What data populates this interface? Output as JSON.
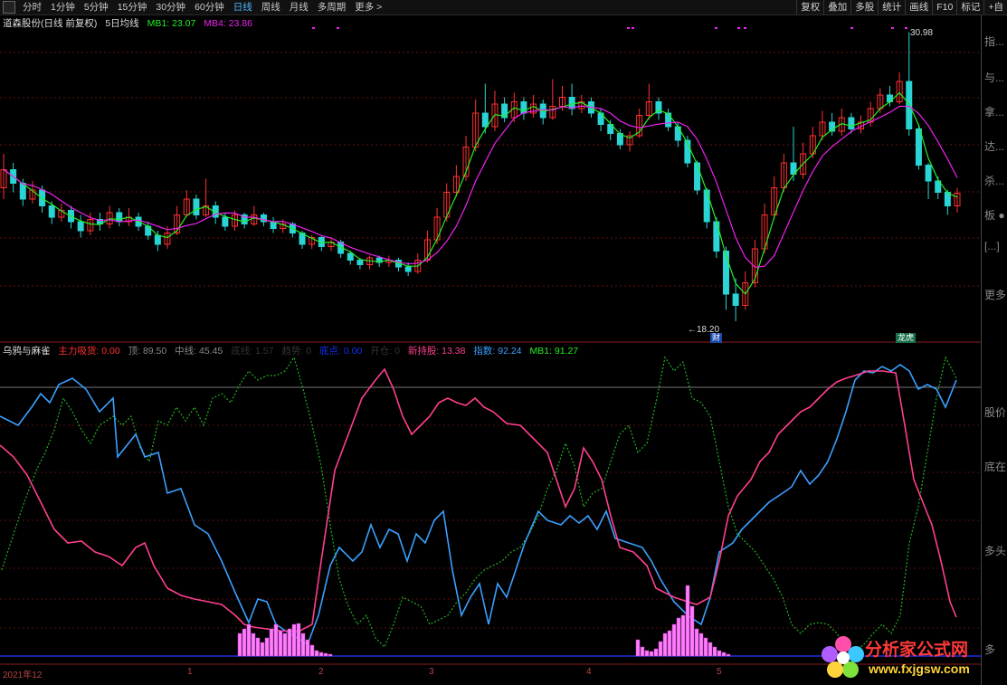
{
  "toolbar": {
    "periods": [
      "分时",
      "1分钟",
      "5分钟",
      "15分钟",
      "30分钟",
      "60分钟",
      "日线",
      "周线",
      "月线",
      "多周期",
      "更多 >"
    ],
    "active_period": "日线",
    "right_buttons": [
      "复权",
      "叠加",
      "多股",
      "统计",
      "画线",
      "F10",
      "标记",
      "+自"
    ]
  },
  "stock": {
    "name": "道森股份(日线 前复权)",
    "ma_label": "5日均线",
    "mb1": "MB1: 23.07",
    "mb4": "MB4: 23.86",
    "high_label": "30.98",
    "low_label": "←18.20",
    "badge_cai": "财",
    "badge_longhu": "龙虎"
  },
  "indicator": {
    "name": "乌鸦与麻雀",
    "zhuli": "主力吸货: 0.00",
    "ding": "顶: 89.50",
    "zhongxian": "中线: 45.45",
    "dim1": "底线: 1.57",
    "dim2": "趋势: 0",
    "bottom": "底点: 0.00",
    "dim3": "开仓: 0",
    "holder": "新持股: 13.38",
    "index": "指数: 92.24",
    "mb1": "MB1: 91.27"
  },
  "right_panel": [
    "指...",
    "与...",
    "拿...",
    "达...",
    "杀...",
    "板 ●",
    "[...]",
    "更多",
    "股价",
    "底在",
    "多头",
    "多"
  ],
  "axis": {
    "d0": "2021年12",
    "d1": "1",
    "d2": "2",
    "d3": "3",
    "d4": "4",
    "d5": "5"
  },
  "watermark": {
    "title": "分析家公式网",
    "url": "www.fxjgsw.com"
  },
  "colors": {
    "up": "#ff3030",
    "down": "#2ad4d4",
    "ma_green": "#22ee22",
    "ma_magenta": "#ee22ee",
    "pink": "#ff3f8f",
    "blue": "#3aa0ff",
    "dotted": "#22b022",
    "bar": "#ff7cff"
  },
  "chart_data": {
    "type": "candlestick+lines",
    "candles_approx": [
      {
        "o": 24.1,
        "c": 24.9,
        "h": 25.6,
        "l": 23.6
      },
      {
        "o": 24.9,
        "c": 24.3,
        "h": 25.2,
        "l": 23.9
      },
      {
        "o": 24.3,
        "c": 23.6,
        "h": 24.5,
        "l": 23.3
      },
      {
        "o": 23.6,
        "c": 24.0,
        "h": 24.4,
        "l": 23.4
      },
      {
        "o": 24.0,
        "c": 23.3,
        "h": 24.2,
        "l": 23.0
      },
      {
        "o": 23.3,
        "c": 22.8,
        "h": 23.5,
        "l": 22.5
      },
      {
        "o": 22.8,
        "c": 23.1,
        "h": 23.4,
        "l": 22.6
      },
      {
        "o": 23.1,
        "c": 22.6,
        "h": 23.3,
        "l": 22.3
      },
      {
        "o": 22.6,
        "c": 22.2,
        "h": 22.9,
        "l": 21.9
      },
      {
        "o": 22.2,
        "c": 22.7,
        "h": 23.0,
        "l": 22.0
      },
      {
        "o": 22.7,
        "c": 22.5,
        "h": 23.0,
        "l": 22.2
      },
      {
        "o": 22.5,
        "c": 23.0,
        "h": 23.3,
        "l": 22.3
      },
      {
        "o": 23.0,
        "c": 22.6,
        "h": 23.2,
        "l": 22.4
      },
      {
        "o": 22.6,
        "c": 22.8,
        "h": 23.2,
        "l": 22.4
      },
      {
        "o": 22.8,
        "c": 22.4,
        "h": 23.0,
        "l": 22.2
      },
      {
        "o": 22.4,
        "c": 22.0,
        "h": 22.6,
        "l": 21.8
      },
      {
        "o": 22.0,
        "c": 21.6,
        "h": 22.2,
        "l": 21.3
      },
      {
        "o": 21.6,
        "c": 22.1,
        "h": 22.4,
        "l": 21.4
      },
      {
        "o": 22.1,
        "c": 22.9,
        "h": 23.3,
        "l": 22.0
      },
      {
        "o": 22.9,
        "c": 23.6,
        "h": 24.0,
        "l": 22.8
      },
      {
        "o": 23.6,
        "c": 22.9,
        "h": 23.8,
        "l": 22.7
      },
      {
        "o": 22.9,
        "c": 23.3,
        "h": 24.5,
        "l": 22.8
      },
      {
        "o": 23.3,
        "c": 22.8,
        "h": 23.5,
        "l": 22.5
      },
      {
        "o": 22.8,
        "c": 22.4,
        "h": 23.0,
        "l": 22.2
      },
      {
        "o": 22.4,
        "c": 22.9,
        "h": 23.1,
        "l": 22.2
      },
      {
        "o": 22.9,
        "c": 22.5,
        "h": 23.0,
        "l": 22.3
      },
      {
        "o": 22.5,
        "c": 22.9,
        "h": 23.3,
        "l": 22.4
      },
      {
        "o": 22.9,
        "c": 22.6,
        "h": 23.0,
        "l": 22.4
      },
      {
        "o": 22.6,
        "c": 22.3,
        "h": 22.8,
        "l": 22.1
      },
      {
        "o": 22.3,
        "c": 22.5,
        "h": 22.7,
        "l": 22.1
      },
      {
        "o": 22.5,
        "c": 22.1,
        "h": 22.6,
        "l": 21.9
      },
      {
        "o": 22.1,
        "c": 21.6,
        "h": 22.2,
        "l": 21.4
      },
      {
        "o": 21.6,
        "c": 21.9,
        "h": 22.0,
        "l": 21.4
      },
      {
        "o": 21.9,
        "c": 21.5,
        "h": 22.0,
        "l": 21.3
      },
      {
        "o": 21.5,
        "c": 21.7,
        "h": 21.9,
        "l": 21.3
      },
      {
        "o": 21.7,
        "c": 21.2,
        "h": 21.8,
        "l": 21.0
      },
      {
        "o": 21.2,
        "c": 20.9,
        "h": 21.3,
        "l": 20.7
      },
      {
        "o": 20.9,
        "c": 20.7,
        "h": 21.0,
        "l": 20.5
      },
      {
        "o": 20.7,
        "c": 21.0,
        "h": 21.1,
        "l": 20.5
      },
      {
        "o": 21.0,
        "c": 20.8,
        "h": 21.1,
        "l": 20.6
      },
      {
        "o": 20.8,
        "c": 20.9,
        "h": 21.1,
        "l": 20.6
      },
      {
        "o": 20.9,
        "c": 20.6,
        "h": 21.0,
        "l": 20.4
      },
      {
        "o": 20.6,
        "c": 20.4,
        "h": 20.8,
        "l": 20.2
      },
      {
        "o": 20.4,
        "c": 20.9,
        "h": 21.2,
        "l": 20.3
      },
      {
        "o": 20.9,
        "c": 21.8,
        "h": 22.2,
        "l": 20.8
      },
      {
        "o": 21.8,
        "c": 22.8,
        "h": 23.2,
        "l": 21.6
      },
      {
        "o": 22.8,
        "c": 23.9,
        "h": 24.3,
        "l": 22.6
      },
      {
        "o": 23.9,
        "c": 24.6,
        "h": 25.1,
        "l": 23.7
      },
      {
        "o": 24.6,
        "c": 25.9,
        "h": 26.4,
        "l": 24.4
      },
      {
        "o": 25.9,
        "c": 27.4,
        "h": 28.0,
        "l": 25.7
      },
      {
        "o": 27.4,
        "c": 26.8,
        "h": 28.7,
        "l": 26.5
      },
      {
        "o": 26.8,
        "c": 27.8,
        "h": 28.4,
        "l": 26.6
      },
      {
        "o": 27.8,
        "c": 27.2,
        "h": 28.1,
        "l": 27.0
      },
      {
        "o": 27.2,
        "c": 27.9,
        "h": 28.3,
        "l": 27.0
      },
      {
        "o": 27.9,
        "c": 27.4,
        "h": 28.1,
        "l": 27.1
      },
      {
        "o": 27.4,
        "c": 27.8,
        "h": 28.2,
        "l": 27.2
      },
      {
        "o": 27.8,
        "c": 27.2,
        "h": 28.0,
        "l": 26.9
      },
      {
        "o": 27.2,
        "c": 27.7,
        "h": 28.9,
        "l": 27.1
      },
      {
        "o": 27.7,
        "c": 28.1,
        "h": 28.6,
        "l": 27.5
      },
      {
        "o": 28.1,
        "c": 27.6,
        "h": 28.7,
        "l": 27.3
      },
      {
        "o": 27.6,
        "c": 27.9,
        "h": 28.2,
        "l": 27.4
      },
      {
        "o": 27.9,
        "c": 27.4,
        "h": 28.1,
        "l": 27.2
      },
      {
        "o": 27.4,
        "c": 26.9,
        "h": 27.6,
        "l": 26.6
      },
      {
        "o": 26.9,
        "c": 26.5,
        "h": 27.1,
        "l": 26.2
      },
      {
        "o": 26.5,
        "c": 26.0,
        "h": 26.7,
        "l": 25.8
      },
      {
        "o": 26.0,
        "c": 26.4,
        "h": 26.6,
        "l": 25.7
      },
      {
        "o": 26.4,
        "c": 27.3,
        "h": 27.6,
        "l": 26.3
      },
      {
        "o": 27.3,
        "c": 27.9,
        "h": 28.7,
        "l": 27.1
      },
      {
        "o": 27.9,
        "c": 27.4,
        "h": 28.1,
        "l": 27.1
      },
      {
        "o": 27.4,
        "c": 26.8,
        "h": 27.6,
        "l": 26.6
      },
      {
        "o": 26.8,
        "c": 26.2,
        "h": 27.0,
        "l": 25.9
      },
      {
        "o": 26.2,
        "c": 25.2,
        "h": 26.4,
        "l": 25.0
      },
      {
        "o": 25.2,
        "c": 24.0,
        "h": 25.3,
        "l": 23.8
      },
      {
        "o": 24.0,
        "c": 22.6,
        "h": 24.1,
        "l": 22.3
      },
      {
        "o": 22.6,
        "c": 21.3,
        "h": 22.8,
        "l": 21.0
      },
      {
        "o": 21.3,
        "c": 19.4,
        "h": 21.5,
        "l": 18.7
      },
      {
        "o": 19.4,
        "c": 18.9,
        "h": 20.1,
        "l": 18.2
      },
      {
        "o": 18.9,
        "c": 19.9,
        "h": 20.4,
        "l": 18.7
      },
      {
        "o": 19.9,
        "c": 21.4,
        "h": 21.8,
        "l": 19.7
      },
      {
        "o": 21.4,
        "c": 22.9,
        "h": 23.4,
        "l": 21.2
      },
      {
        "o": 22.9,
        "c": 24.1,
        "h": 24.6,
        "l": 22.7
      },
      {
        "o": 24.1,
        "c": 25.2,
        "h": 25.6,
        "l": 23.9
      },
      {
        "o": 25.2,
        "c": 24.7,
        "h": 26.8,
        "l": 24.4
      },
      {
        "o": 24.7,
        "c": 25.6,
        "h": 26.1,
        "l": 24.5
      },
      {
        "o": 25.6,
        "c": 26.4,
        "h": 26.8,
        "l": 25.4
      },
      {
        "o": 26.4,
        "c": 27.0,
        "h": 27.5,
        "l": 26.2
      },
      {
        "o": 27.0,
        "c": 26.6,
        "h": 27.4,
        "l": 26.4
      },
      {
        "o": 26.6,
        "c": 27.2,
        "h": 27.6,
        "l": 26.4
      },
      {
        "o": 27.2,
        "c": 26.7,
        "h": 27.4,
        "l": 26.5
      },
      {
        "o": 26.7,
        "c": 27.0,
        "h": 27.3,
        "l": 26.5
      },
      {
        "o": 27.0,
        "c": 27.6,
        "h": 27.9,
        "l": 26.8
      },
      {
        "o": 27.6,
        "c": 28.2,
        "h": 28.5,
        "l": 27.4
      },
      {
        "o": 28.2,
        "c": 27.9,
        "h": 28.6,
        "l": 27.7
      },
      {
        "o": 27.9,
        "c": 28.8,
        "h": 29.2,
        "l": 27.8
      },
      {
        "o": 28.8,
        "c": 26.7,
        "h": 30.98,
        "l": 26.4
      },
      {
        "o": 26.7,
        "c": 25.1,
        "h": 26.9,
        "l": 24.9
      },
      {
        "o": 25.1,
        "c": 24.4,
        "h": 25.2,
        "l": 23.6
      },
      {
        "o": 24.4,
        "c": 23.9,
        "h": 24.6,
        "l": 23.6
      },
      {
        "o": 23.9,
        "c": 23.3,
        "h": 24.0,
        "l": 22.9
      },
      {
        "o": 23.3,
        "c": 23.86,
        "h": 24.1,
        "l": 23.0
      }
    ]
  }
}
